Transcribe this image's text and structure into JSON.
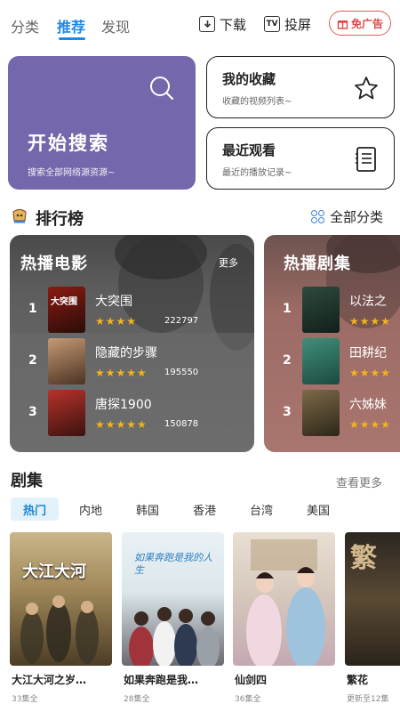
{
  "nav": {
    "tabs": [
      "分类",
      "推荐",
      "发现"
    ],
    "active_index": 1,
    "download_label": "下载",
    "cast_label": "投屏",
    "adfree_label": "免广告",
    "cast_icon_text": "TV"
  },
  "quick": {
    "search": {
      "title": "开始搜索",
      "subtitle": "搜索全部网络源资源~"
    },
    "favorites": {
      "title": "我的收藏",
      "subtitle": "收藏的视频列表~"
    },
    "history": {
      "title": "最近观看",
      "subtitle": "最近的播放记录~"
    }
  },
  "ranking": {
    "heading": "排行榜",
    "all_categories": "全部分类",
    "movies": {
      "title": "热播电影",
      "more": "更多",
      "items": [
        {
          "rank": "1",
          "name": "大突围",
          "stars": "★★★★",
          "count": "222797",
          "poster_text": "大突围"
        },
        {
          "rank": "2",
          "name": "隐藏的步骤",
          "stars": "★★★★★",
          "count": "195550"
        },
        {
          "rank": "3",
          "name": "唐探1900",
          "stars": "★★★★★",
          "count": "150878"
        }
      ]
    },
    "series": {
      "title": "热播剧集",
      "items": [
        {
          "rank": "1",
          "name": "以法之",
          "stars": "★★★★"
        },
        {
          "rank": "2",
          "name": "田耕纪",
          "stars": "★★★★"
        },
        {
          "rank": "3",
          "name": "六姊妹",
          "stars": "★★★★"
        }
      ]
    }
  },
  "drama": {
    "heading": "剧集",
    "more": "查看更多",
    "chips": [
      "热门",
      "内地",
      "韩国",
      "香港",
      "台湾",
      "美国"
    ],
    "active_chip": 0,
    "items": [
      {
        "title": "大江大河之岁…",
        "sub": "33集全",
        "poster_text": "大江大河"
      },
      {
        "title": "如果奔跑是我…",
        "sub": "28集全",
        "poster_text": "如果奔跑是我的人生"
      },
      {
        "title": "仙剑四",
        "sub": "36集全"
      },
      {
        "title": "繁花",
        "sub": "更新至12集",
        "poster_text": "繁"
      }
    ]
  },
  "colors": {
    "accent": "#1e88e5",
    "search_card": "#7567ab",
    "movie_card": "#6d6d6d",
    "series_card": "#a0706a",
    "star": "#f2b31c",
    "adfree": "#e04747"
  }
}
